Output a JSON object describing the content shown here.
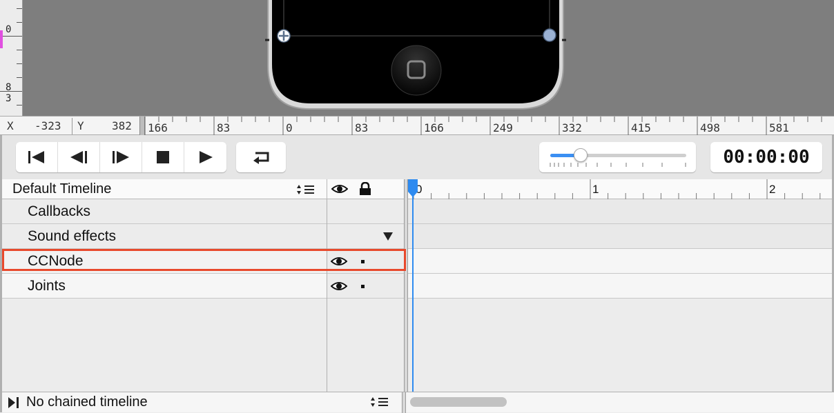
{
  "canvas": {
    "vruler_labels": [
      "0",
      "8",
      "3"
    ],
    "coords": {
      "x_label": "X",
      "x_value": "-323",
      "y_label": "Y",
      "y_value": "382"
    },
    "hruler_labels": [
      "166",
      "83",
      "0",
      "83",
      "166",
      "249",
      "332",
      "415",
      "498",
      "581"
    ]
  },
  "playback": {
    "buttons": [
      "jump-to-start",
      "step-back",
      "step-forward",
      "stop",
      "play",
      "loop"
    ],
    "timecode": "00:00:00",
    "zoom_level": 0.22
  },
  "timeline": {
    "selector_label": "Default Timeline",
    "ruler_labels": [
      "0",
      "1",
      "2"
    ],
    "rows": [
      {
        "label": "Callbacks",
        "has_visibility": false
      },
      {
        "label": "Sound effects",
        "has_visibility": false
      },
      {
        "label": "CCNode",
        "has_visibility": true,
        "highlighted": true
      },
      {
        "label": "Joints",
        "has_visibility": true
      }
    ]
  },
  "bottom": {
    "chained_label": "No chained timeline"
  },
  "colors": {
    "playhead": "#2e8bf0",
    "highlight": "#e8492c",
    "slider": "#3b8ff2"
  }
}
